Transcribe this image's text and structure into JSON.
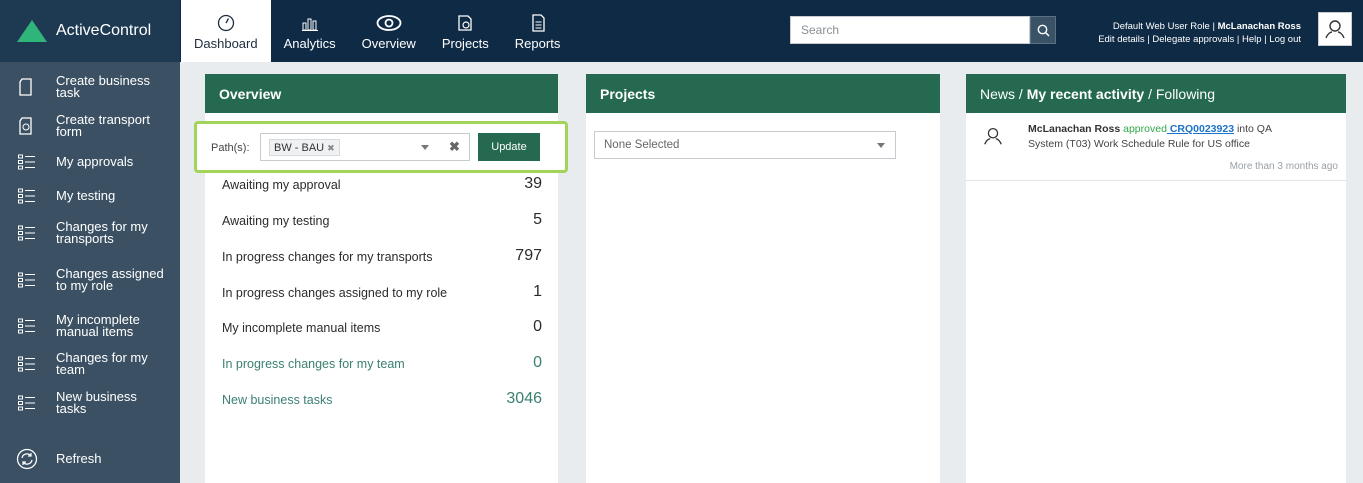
{
  "app": {
    "name": "ActiveControl"
  },
  "nav": [
    {
      "label": "Dashboard",
      "icon": "dashboard-icon",
      "active": true
    },
    {
      "label": "Analytics",
      "icon": "analytics-icon"
    },
    {
      "label": "Overview",
      "icon": "eye-icon"
    },
    {
      "label": "Projects",
      "icon": "projects-icon"
    },
    {
      "label": "Reports",
      "icon": "reports-icon"
    }
  ],
  "search": {
    "placeholder": "Search"
  },
  "user": {
    "role": "Default Web User Role | ",
    "name": "McLanachan Ross",
    "links": "Edit details | Delegate approvals | Help | Log out"
  },
  "sidebar": {
    "items": [
      {
        "label": "Create business task",
        "icon": "document-icon"
      },
      {
        "label": "Create transport form",
        "icon": "form-icon"
      },
      {
        "label": "My approvals",
        "icon": "list-icon"
      },
      {
        "label": "My testing",
        "icon": "list-icon"
      },
      {
        "label": "Changes for my transports",
        "icon": "list-icon"
      },
      {
        "label": "Changes assigned to my role",
        "icon": "list-icon"
      },
      {
        "label": "My incomplete manual items",
        "icon": "list-icon"
      },
      {
        "label": "Changes for my team",
        "icon": "list-icon"
      },
      {
        "label": "New business tasks",
        "icon": "list-icon"
      }
    ],
    "refresh": "Refresh"
  },
  "overview": {
    "title": "Overview",
    "path_label": "Path(s):",
    "path_tag": "BW - BAU",
    "update": "Update",
    "rows": [
      {
        "label": "Awaiting my approval",
        "value": "39"
      },
      {
        "label": "Awaiting my testing",
        "value": "5"
      },
      {
        "label": "In progress changes for my transports",
        "value": "797"
      },
      {
        "label": "In progress changes assigned to my role",
        "value": "1"
      },
      {
        "label": "My incomplete manual items",
        "value": "0"
      },
      {
        "label": "In progress changes for my team",
        "value": "0"
      },
      {
        "label": "New business tasks",
        "value": "3046"
      }
    ]
  },
  "projects": {
    "title": "Projects",
    "select_value": "None Selected"
  },
  "news": {
    "title_a": "News / ",
    "title_b": "My recent activity",
    "title_c": " / Following",
    "item": {
      "who": "McLanachan Ross",
      "verb": " approved",
      "link": " CRQ0023923",
      "rest": " into QA",
      "line2": "System (T03) Work Schedule Rule for US office",
      "time": "More than 3 months ago"
    }
  },
  "colors": {
    "accent": "#256a50",
    "topbar": "#0e2a45",
    "sidebar": "#3b5163",
    "highlight": "#a2d45a"
  }
}
